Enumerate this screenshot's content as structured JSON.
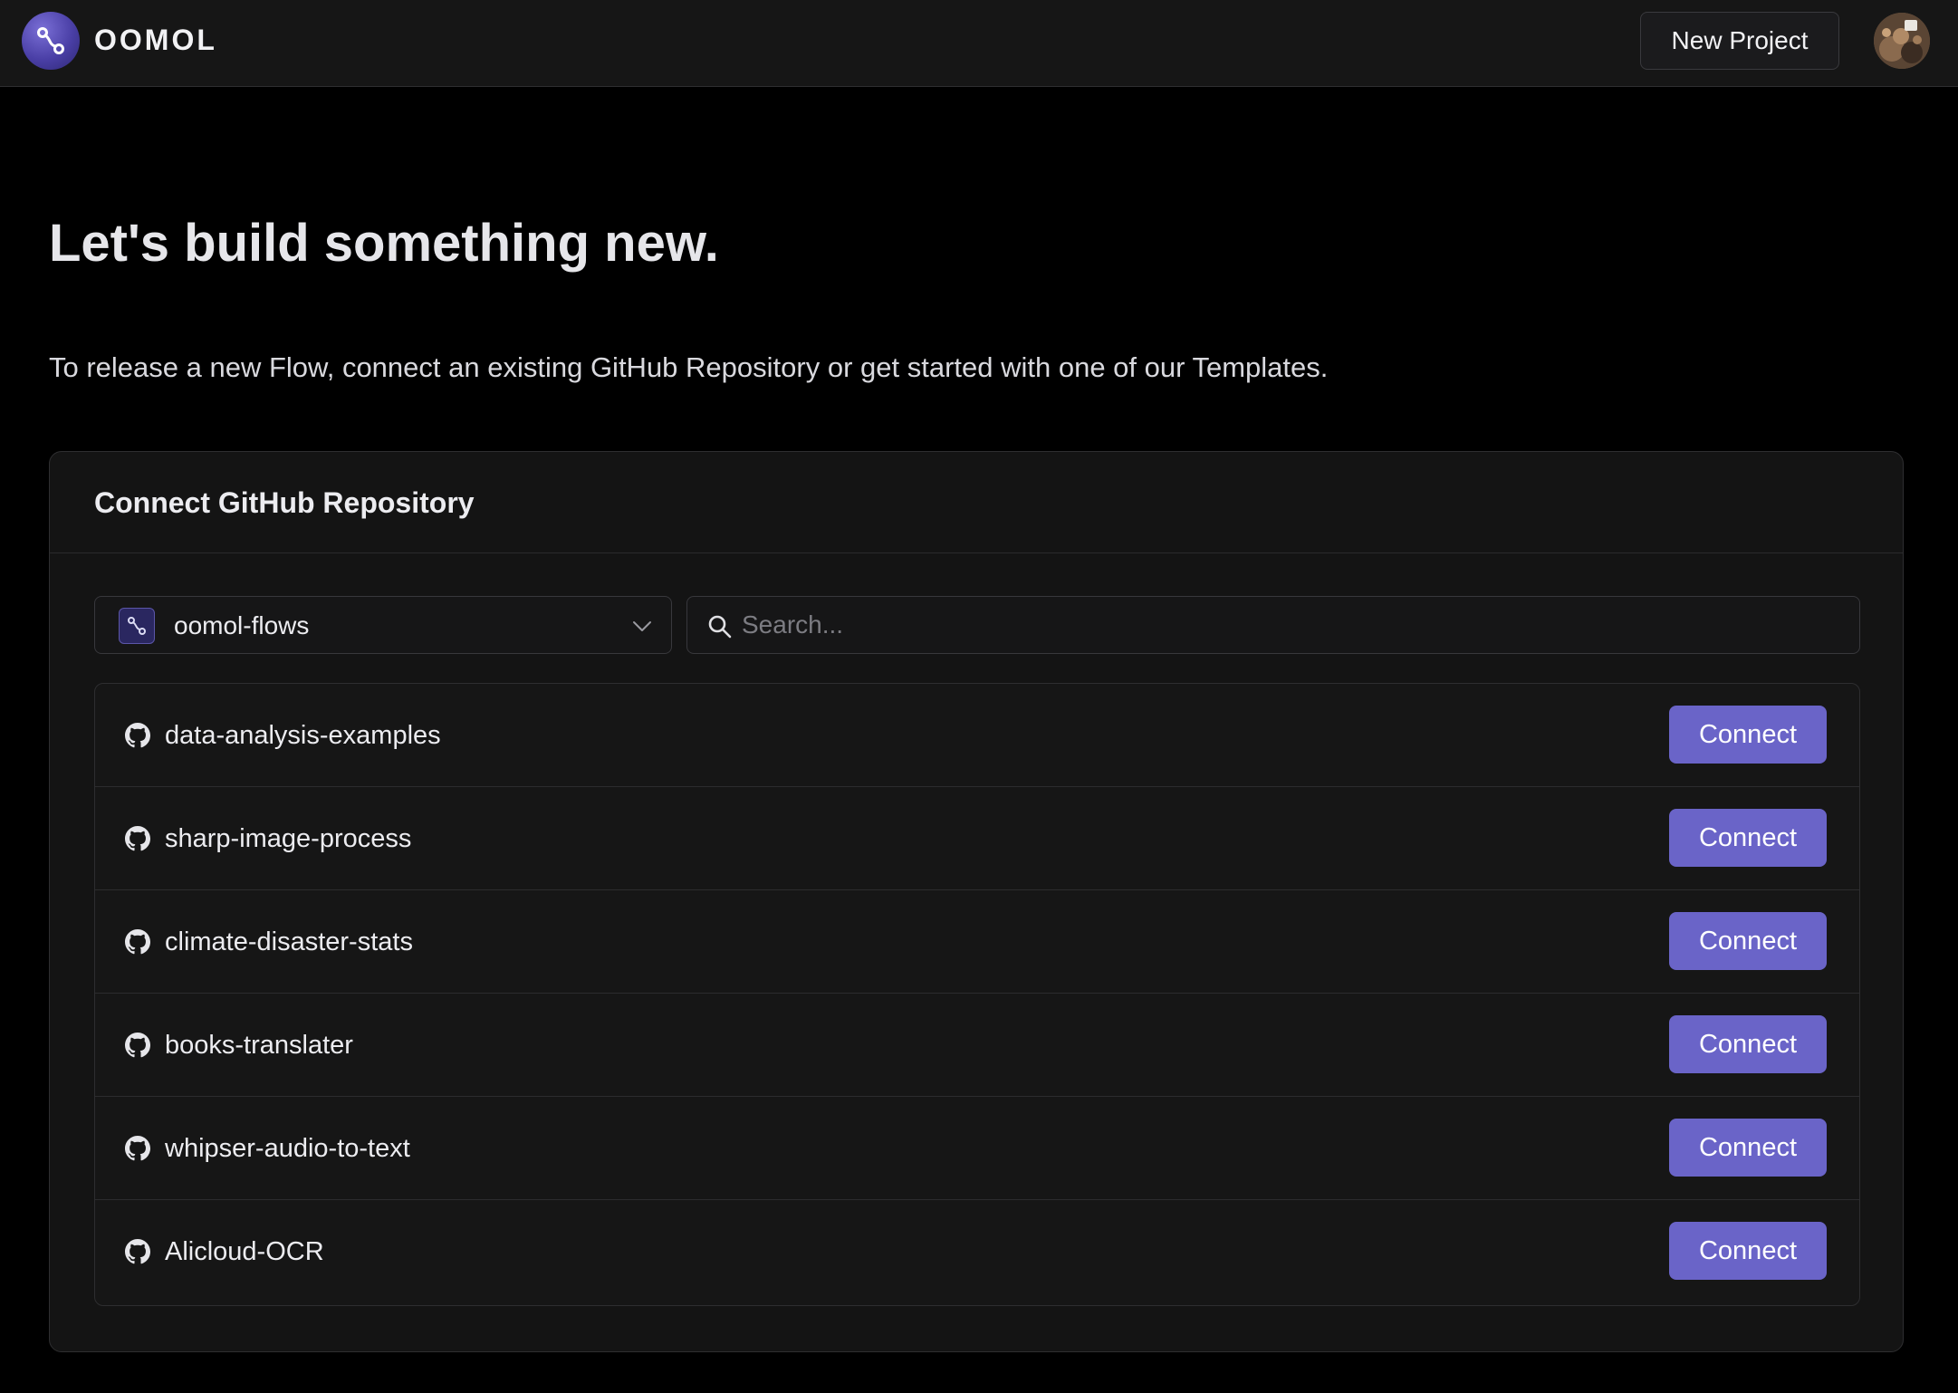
{
  "header": {
    "logo_text": "OOMOL",
    "new_project_label": "New Project"
  },
  "hero": {
    "title": "Let's build something new.",
    "subtitle": "To release a new Flow, connect an existing GitHub Repository or get started with one of our Templates."
  },
  "connect_card": {
    "title": "Connect GitHub Repository",
    "org_select": {
      "selected": "oomol-flows"
    },
    "search": {
      "placeholder": "Search...",
      "value": ""
    },
    "connect_label": "Connect",
    "repos": [
      {
        "name": "data-analysis-examples"
      },
      {
        "name": "sharp-image-process"
      },
      {
        "name": "climate-disaster-stats"
      },
      {
        "name": "books-translater"
      },
      {
        "name": "whipser-audio-to-text"
      },
      {
        "name": "Alicloud-OCR"
      }
    ]
  },
  "colors": {
    "accent": "#6a64c8",
    "background": "#000000",
    "surface": "#141414",
    "border": "#2e2e30"
  },
  "icons": {
    "logo": "oomol-flow-icon",
    "org": "oomol-flow-icon",
    "chevron": "chevron-down-icon",
    "search": "search-icon",
    "repo": "github-icon"
  }
}
